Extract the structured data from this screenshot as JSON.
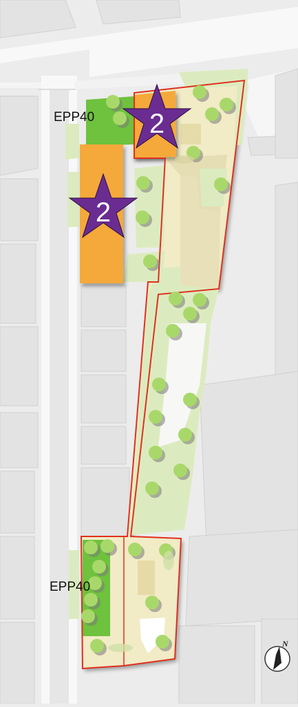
{
  "labels": {
    "epp_top": "EPP40",
    "epp_bottom": "EPP40"
  },
  "markers": {
    "star_top": "2",
    "star_left": "2",
    "star_color": "#6a2c91"
  },
  "compass": {
    "north": "N"
  },
  "colors": {
    "background": "#ececec",
    "road": "#f7f7f7",
    "block": "#dcdcdc",
    "boundary": "#e0301e",
    "plot_beige": "#f1ebc6",
    "green_light": "#dcebbf",
    "green_dark": "#6ec23d",
    "orange": "#f5a93a",
    "tree": "#a9d86a"
  }
}
